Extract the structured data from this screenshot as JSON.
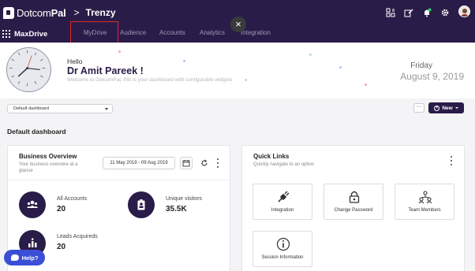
{
  "topbar": {
    "logo_prefix": "Dotcom",
    "logo_suffix": "Pal",
    "crumb_sep": ">",
    "crumb": "Trenzy"
  },
  "navbar": {
    "app_name": "MaxDrive",
    "tabs": [
      "MyDrive",
      "Audience",
      "Accounts",
      "Analytics",
      "Integration"
    ],
    "close_glyph": "×"
  },
  "hero": {
    "hello": "Hello",
    "name": "Dr Amit Pareek !",
    "subtitle": "Welcome to DotcomPal, this is your dashboard with configurable widgets",
    "day": "Friday",
    "date": "August 9, 2019"
  },
  "toolbar": {
    "dashboard_select": "Default dashboard",
    "more": "···",
    "new_label": "New",
    "new_plus": "+"
  },
  "section_title": "Default dashboard",
  "business_overview": {
    "title": "Business Overview",
    "subtitle_line1": "Your business overview at a",
    "subtitle_line2": "glance",
    "date_range": "11 May 2019 - 09 Aug 2019",
    "stats": [
      {
        "label": "All Accounts",
        "value": "20",
        "icon": "users-icon"
      },
      {
        "label": "Unique visitors",
        "value": "35.5K",
        "icon": "visitor-badge-icon"
      },
      {
        "label": "Leads Acquireds",
        "value": "20",
        "icon": "leads-chart-icon"
      }
    ]
  },
  "quick_links": {
    "title": "Quick Links",
    "subtitle": "Quickly navigate to an option",
    "tiles": [
      {
        "label": "Integration",
        "icon": "plug-icon"
      },
      {
        "label": "Change Password",
        "icon": "lock-icon"
      },
      {
        "label": "Team Members",
        "icon": "team-icon"
      },
      {
        "label": "Session Information",
        "icon": "info-icon"
      }
    ]
  },
  "help": {
    "label": "Help?"
  },
  "colors": {
    "brand": "#2a1c48",
    "highlight": "#e0282a",
    "help": "#3a4fd6"
  }
}
